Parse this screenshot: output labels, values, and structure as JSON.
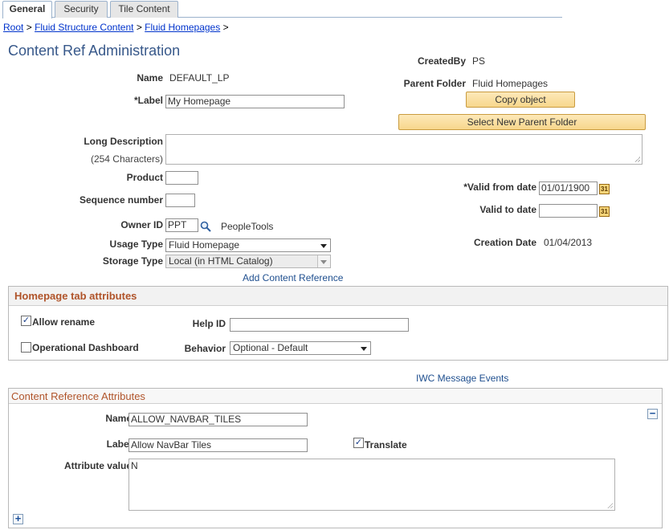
{
  "tabs": [
    {
      "label": "General",
      "active": true
    },
    {
      "label": "Security",
      "active": false
    },
    {
      "label": "Tile Content",
      "active": false
    }
  ],
  "breadcrumb": {
    "items": [
      "Root",
      "Fluid Structure Content",
      "Fluid Homepages"
    ],
    "separator": ">"
  },
  "page_title": "Content Ref Administration",
  "fields": {
    "name_label": "Name",
    "name_value": "DEFAULT_LP",
    "label_label": "*Label",
    "label_value": "My Homepage",
    "long_desc_label": "Long Description",
    "long_desc_hint": "(254 Characters)",
    "long_desc_value": "",
    "product_label": "Product",
    "product_value": "",
    "sequence_label": "Sequence number",
    "sequence_value": "",
    "owner_label": "Owner ID",
    "owner_value": "PPT",
    "owner_desc": "PeopleTools",
    "usage_label": "Usage Type",
    "usage_value": "Fluid Homepage",
    "storage_label": "Storage Type",
    "storage_value": "Local (in HTML Catalog)",
    "add_content_ref_link": "Add Content Reference"
  },
  "right_panel": {
    "created_by_label": "CreatedBy",
    "created_by_value": "PS",
    "parent_folder_label": "Parent Folder",
    "parent_folder_value": "Fluid Homepages",
    "copy_button": "Copy object",
    "select_parent_button": "Select New Parent Folder",
    "valid_from_label": "*Valid from date",
    "valid_from_value": "01/01/1900",
    "valid_to_label": "Valid to date",
    "valid_to_value": "",
    "creation_date_label": "Creation Date",
    "creation_date_value": "01/04/2013",
    "calendar_glyph": "31"
  },
  "homepage_tab": {
    "title": "Homepage tab attributes",
    "allow_rename_label": "Allow rename",
    "allow_rename_checked": true,
    "operational_dashboard_label": "Operational Dashboard",
    "operational_dashboard_checked": false,
    "help_id_label": "Help ID",
    "help_id_value": "",
    "behavior_label": "Behavior",
    "behavior_value": "Optional - Default"
  },
  "iwc_link": "IWC Message Events",
  "content_ref_attrs": {
    "title": "Content Reference Attributes",
    "name_label": "Name",
    "name_value": "ALLOW_NAVBAR_TILES",
    "label_label": "Label",
    "label_value": "Allow NavBar Tiles",
    "translate_label": "Translate",
    "translate_checked": true,
    "attr_value_label": "Attribute value",
    "attr_value": "N",
    "collapse_glyph": "−",
    "add_glyph": "+"
  },
  "check_glyph": "✓",
  "icons": {
    "lookup": "magnifier-icon",
    "calendar": "calendar-icon",
    "dropdown": "chevron-down-icon"
  },
  "colors": {
    "title_blue": "#37588a",
    "group_title_orange": "#b0542a",
    "button_fill": "#f7d78c",
    "link_blue": "#1f4f8f"
  }
}
